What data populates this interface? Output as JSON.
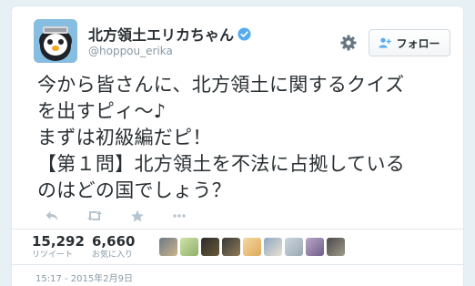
{
  "user": {
    "display_name": "北方領土エリカちゃん",
    "handle": "@hoppou_erika"
  },
  "follow_button": {
    "label": "フォロー"
  },
  "tweet": {
    "lines": [
      "今から皆さんに、北方領土に関するクイズ",
      "を出すピィ〜♪",
      "まずは初級編だピ！",
      "【第１問】北方領土を不法に占拠している",
      "のはどの国でしょう？"
    ]
  },
  "stats": {
    "retweets": "15,292",
    "retweets_label": "リツイート",
    "favorites": "6,660",
    "favorites_label": "お気に入り"
  },
  "timestamp": "15:17 - 2015年2月9日",
  "colors": {
    "verified": "#55acee",
    "text": "#292f33",
    "muted": "#8899a6",
    "follow_icon": "#55acee"
  }
}
